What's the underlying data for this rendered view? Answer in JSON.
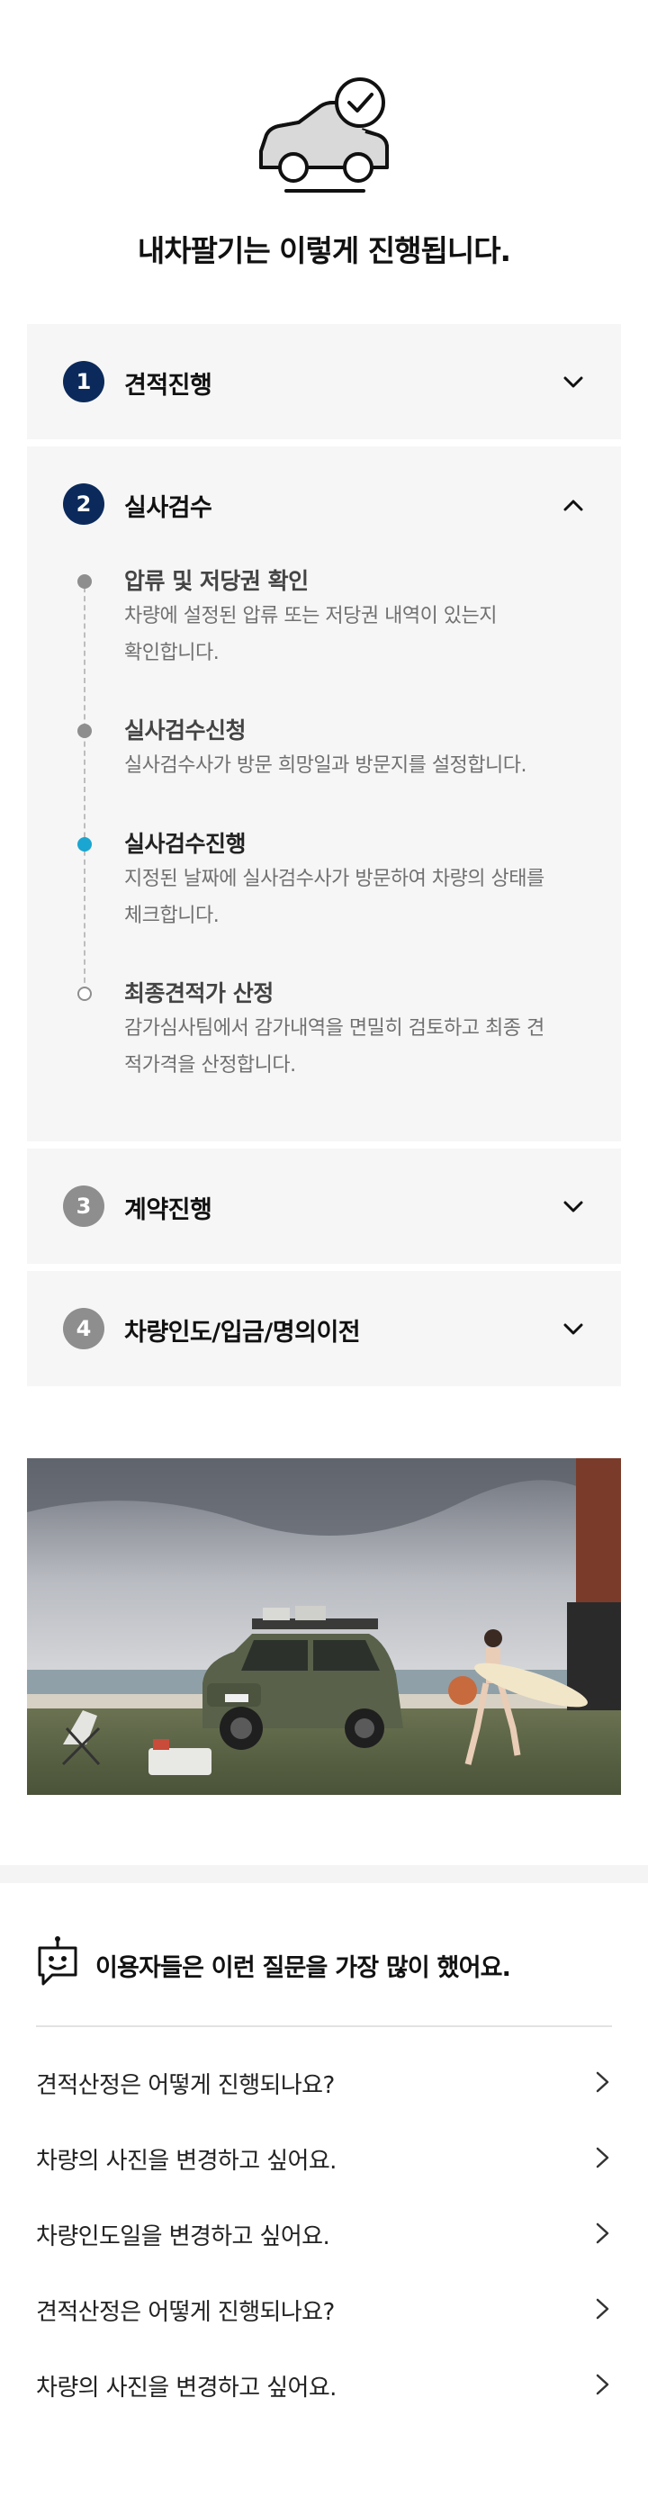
{
  "hero": {
    "title": "내차팔기는 이렇게 진행됩니다.",
    "icon": "car-check-icon"
  },
  "steps": [
    {
      "number": "1",
      "title": "견적진행",
      "expanded": false,
      "status": "active"
    },
    {
      "number": "2",
      "title": "실사검수",
      "expanded": true,
      "status": "active",
      "substeps": [
        {
          "title": "압류 및 저당권 확인",
          "desc_lines": [
            "차량에 설정된 압류 또는 저당권 내역이 있는지",
            "확인합니다."
          ],
          "state": "done"
        },
        {
          "title": "실사검수신청",
          "desc_lines": [
            "실사검수사가 방문 희망일과 방문지를 설정합니다."
          ],
          "state": "done"
        },
        {
          "title": "실사검수진행",
          "desc_lines": [
            "지정된 날짜에 실사검수사가 방문하여 차량의 상태를",
            "체크합니다."
          ],
          "state": "current"
        },
        {
          "title": "최종견적가 산정",
          "desc_lines": [
            "감가심사팀에서 감가내역을 면밀히 검토하고 최종 견",
            "적가격을 산정합니다."
          ],
          "state": "todo"
        }
      ]
    },
    {
      "number": "3",
      "title": "계약진행",
      "expanded": false,
      "status": "inactive"
    },
    {
      "number": "4",
      "title": "차량인도/입금/명의이전",
      "expanded": false,
      "status": "inactive"
    }
  ],
  "faq": {
    "title": "이용자들은 이런 질문을 가장 많이 했어요.",
    "icon": "chatbot-icon",
    "items": [
      "견적산정은 어떻게 진행되나요?",
      "차량의 사진을 변경하고 싶어요.",
      "차량인도일을 변경하고 싶어요.",
      "견적산정은 어떻게 진행되나요?",
      "차량의 사진을 변경하고 싶어요."
    ]
  },
  "colors": {
    "accent_navy": "#0b2a5b",
    "current_step": "#1aa6d1",
    "panel_bg": "#f6f6f6"
  }
}
